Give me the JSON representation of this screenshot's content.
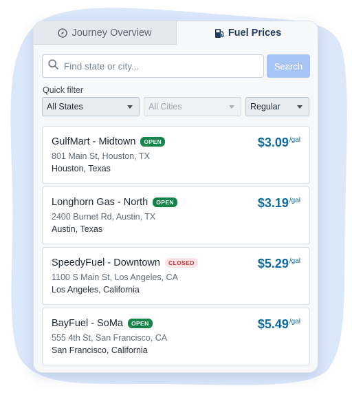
{
  "tabs": [
    {
      "label": "Journey Overview",
      "icon": "compass-icon",
      "active": false
    },
    {
      "label": "Fuel Prices",
      "icon": "fuel-pump-icon",
      "active": true
    }
  ],
  "search": {
    "placeholder": "Find state or city...",
    "value": "",
    "button_label": "Search"
  },
  "filters": {
    "label": "Quick filter",
    "state": "All States",
    "city": "All Cities",
    "fuel_type": "Regular"
  },
  "stations": [
    {
      "name": "GulfMart - Midtown",
      "status": "OPEN",
      "address": "801 Main St, Houston, TX",
      "city": "Houston, Texas",
      "price": "$3.09",
      "unit": "/gal"
    },
    {
      "name": "Longhorn Gas - North",
      "status": "OPEN",
      "address": "2400 Burnet Rd, Austin, TX",
      "city": "Austin, Texas",
      "price": "$3.19",
      "unit": "/gal"
    },
    {
      "name": "SpeedyFuel - Downtown",
      "status": "CLOSED",
      "address": "1100 S Main St, Los Angeles, CA",
      "city": "Los Angeles, California",
      "price": "$5.29",
      "unit": "/gal"
    },
    {
      "name": "BayFuel - SoMa",
      "status": "OPEN",
      "address": "555 4th St, San Francisco, CA",
      "city": "San Francisco, California",
      "price": "$5.49",
      "unit": "/gal"
    }
  ],
  "colors": {
    "accent": "#0f6aa0",
    "open_badge": "#16834a",
    "closed_badge": "#c43a3a",
    "search_button": "#a6c4f4",
    "backdrop": "#dbe7fb"
  }
}
